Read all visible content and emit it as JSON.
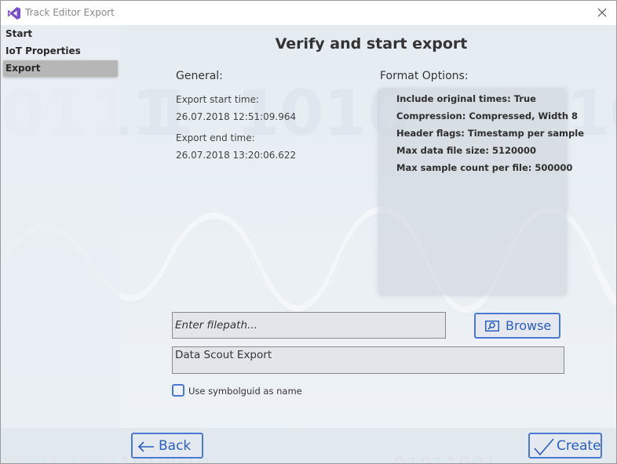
{
  "window": {
    "title": "Track Editor Export"
  },
  "sidebar": {
    "items": [
      {
        "label": "Start"
      },
      {
        "label": "IoT Properties"
      },
      {
        "label": "Export"
      }
    ]
  },
  "main": {
    "heading": "Verify and start export",
    "general": {
      "label": "General:",
      "start_label": "Export start time:",
      "start_value": "26.07.2018 12:51:09.964",
      "end_label": "Export end time:",
      "end_value": "26.07.2018 13:20:06.622"
    },
    "format": {
      "label": "Format Options:",
      "options": [
        "Include original times: True",
        "Compression: Compressed, Width 8",
        "Header flags: Timestamp per sample",
        "Max data file size: 5120000",
        "Max sample count per file: 500000"
      ]
    },
    "filepath": {
      "placeholder": "Enter filepath...",
      "value": ""
    },
    "browse_label": "Browse",
    "name_value": "Data Scout Export",
    "use_symbolguid": {
      "label": "Use symbolguid as name",
      "checked": false
    }
  },
  "footer": {
    "back_label": "Back",
    "create_label": "Create"
  },
  "colors": {
    "accent": "#4a78d2",
    "active_nav": "#b6b6b6",
    "app_icon": "#7b4fc9"
  },
  "icons": {
    "app": "visual-studio-icon",
    "close": "close-icon",
    "browse": "folder-search-icon",
    "back": "arrow-left-icon",
    "create": "checkmark-icon"
  }
}
